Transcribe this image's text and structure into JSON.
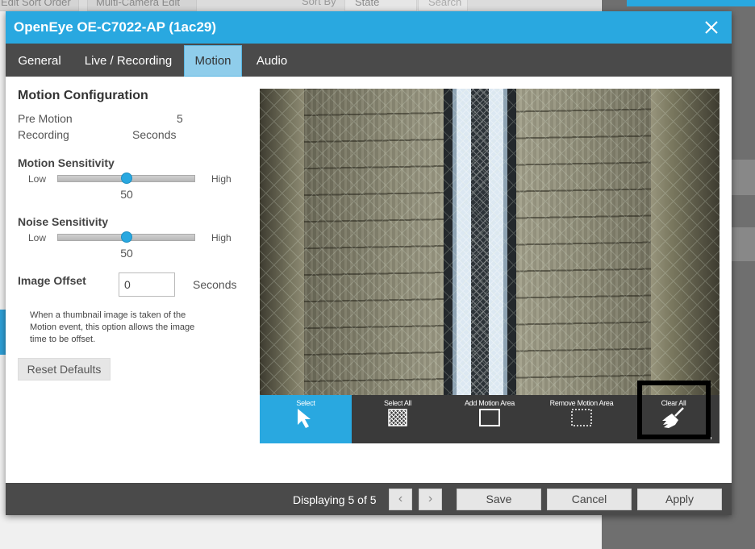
{
  "background": {
    "edit_sort_order_label": "Edit Sort Order",
    "multi_camera_edit_label": "Multi-Camera Edit",
    "sort_by_label": "Sort By",
    "sort_by_value": "State",
    "search_placeholder": "Search"
  },
  "dialog": {
    "title": "OpenEye OE-C7022-AP (1ac29)",
    "tabs": [
      {
        "label": "General"
      },
      {
        "label": "Live / Recording"
      },
      {
        "label": "Motion"
      },
      {
        "label": "Audio"
      }
    ],
    "active_tab": "Motion"
  },
  "motion_config": {
    "heading": "Motion Configuration",
    "pre_motion_label_line1": "Pre Motion",
    "pre_motion_label_line2": "Recording",
    "pre_motion_value": "5",
    "pre_motion_unit": "Seconds",
    "motion_sensitivity": {
      "label": "Motion Sensitivity",
      "low": "Low",
      "high": "High",
      "value": "50",
      "fraction": 0.5
    },
    "noise_sensitivity": {
      "label": "Noise Sensitivity",
      "low": "Low",
      "high": "High",
      "value": "50",
      "fraction": 0.5
    },
    "image_offset": {
      "label": "Image Offset",
      "value": "0",
      "unit": "Seconds"
    },
    "description": "When a thumbnail image is taken of the Motion event, this option allows the image time to be offset.",
    "reset_label": "Reset Defaults"
  },
  "toolbar": {
    "select_label": "Select",
    "select_all_label": "Select All",
    "add_area_label": "Add Motion Area",
    "remove_area_label": "Remove Motion Area",
    "clear_all_label": "Clear All",
    "active_tool": "Select"
  },
  "footer": {
    "paging_text": "Displaying 5 of 5",
    "prev_glyph": "‹",
    "next_glyph": "›",
    "save_label": "Save",
    "cancel_label": "Cancel",
    "apply_label": "Apply"
  },
  "colors": {
    "accent": "#29a8e0",
    "tabbar": "#4a4a4a",
    "active_tab": "#8fcdeb"
  }
}
